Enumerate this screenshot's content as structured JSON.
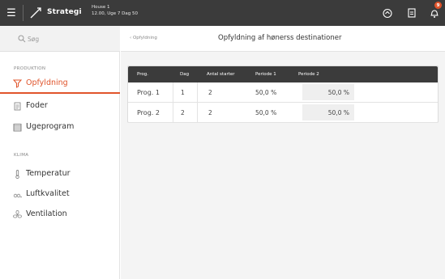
{
  "topbar": {
    "app_title": "Strategi",
    "house_name": "House 1",
    "house_info": "12.00, Uge 7 Dag 50",
    "badge_count": "9"
  },
  "sidebar": {
    "search_placeholder": "Søg",
    "sections": [
      {
        "label": "PRODUKTION",
        "items": [
          {
            "label": "Opfyldning",
            "icon": "feeder-icon",
            "active": true
          },
          {
            "label": "Foder",
            "icon": "document-icon",
            "active": false
          },
          {
            "label": "Ugeprogram",
            "icon": "calendar-icon",
            "active": false
          }
        ]
      },
      {
        "label": "KLIMA",
        "items": [
          {
            "label": "Temperatur",
            "icon": "thermometer-icon",
            "active": false
          },
          {
            "label": "Luftkvalitet",
            "icon": "co2-icon",
            "active": false
          },
          {
            "label": "Ventilation",
            "icon": "fan-icon",
            "active": false
          }
        ]
      }
    ]
  },
  "main": {
    "breadcrumb": "Opfyldning",
    "title": "Opfyldning af hønerss destinationer",
    "table": {
      "headers": [
        "Prog.",
        "Dag",
        "Antal starter",
        "Periode 1",
        "Periode 2"
      ],
      "rows": [
        [
          "Prog. 1",
          "1",
          "2",
          "50,0 %",
          "50,0 %"
        ],
        [
          "Prog. 2",
          "2",
          "2",
          "50,0 %",
          "50,0 %"
        ]
      ]
    }
  },
  "colors": {
    "accent": "#e0542b",
    "topbar": "#3b3b3b",
    "main_bg": "#f4f4f4"
  }
}
